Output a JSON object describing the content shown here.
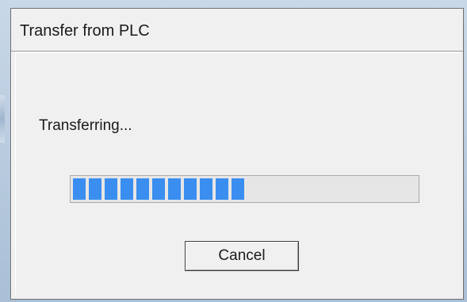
{
  "dialog": {
    "title": "Transfer from PLC",
    "status_text": "Transferring...",
    "progress_fraction": 0.5,
    "progress_color": "#3a8ef0",
    "cancel_label": "Cancel"
  }
}
